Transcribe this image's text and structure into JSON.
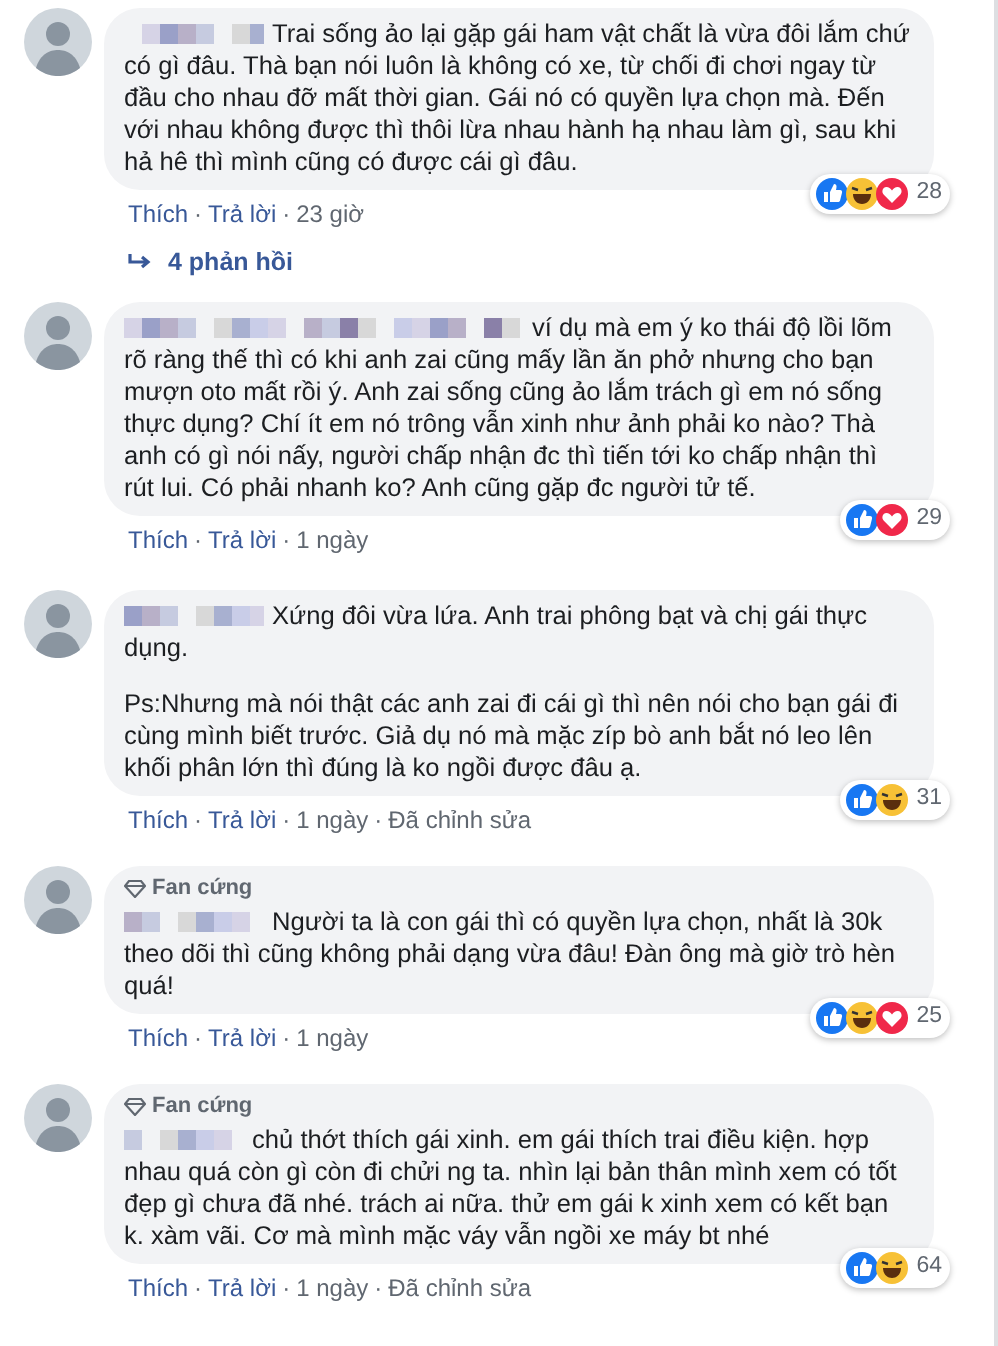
{
  "comments": [
    {
      "paragraphs": [
        "Trai sống ảo lại gặp gái ham vật chất là vừa đôi lắm chứ có gì đâu. Thà bạn nói luôn là không có xe, từ chối đi chơi ngay từ đầu cho nhau đỡ mất thời gian. Gái nó có quyền lựa chọn mà. Đến với nhau không được thì thôi lừa nhau hành hạ nhau làm gì, sau khi hả hê thì mình cũng có được cái gì đâu."
      ],
      "reactions": [
        {
          "kind": "like"
        },
        {
          "kind": "haha"
        },
        {
          "kind": "love"
        }
      ],
      "reaction_count": "28",
      "actions": [
        {
          "kind": "link",
          "text": "Thích"
        },
        {
          "kind": "dot",
          "text": "·"
        },
        {
          "kind": "link",
          "text": "Trả lời"
        },
        {
          "kind": "dot",
          "text": "·"
        },
        {
          "kind": "time",
          "text": "23 giờ"
        }
      ],
      "replies": "4 phản hồi"
    },
    {
      "paragraphs": [
        "ví dụ mà em ý ko thái độ lồi lõm rõ ràng thế thì có khi anh zai cũng mấy lần ăn phở nhưng cho bạn mượn oto mất rồi ý. Anh zai sống cũng ảo lắm trách gì em nó sống thực dụng? Chí ít em nó trông vẫn xinh như ảnh phải ko nào? Thà anh có gì nói nấy, người chấp nhận đc thì tiến tới ko chấp nhận thì rút lui. Có phải nhanh ko? Anh cũng gặp đc người tử tế."
      ],
      "reactions": [
        {
          "kind": "like"
        },
        {
          "kind": "love"
        }
      ],
      "reaction_count": "29",
      "actions": [
        {
          "kind": "link",
          "text": "Thích"
        },
        {
          "kind": "dot",
          "text": "·"
        },
        {
          "kind": "link",
          "text": "Trả lời"
        },
        {
          "kind": "dot",
          "text": "·"
        },
        {
          "kind": "time",
          "text": "1 ngày"
        }
      ]
    },
    {
      "paragraphs": [
        "Xứng đôi vừa lứa. Anh trai phông bạt và chị gái thực dụng.",
        "Ps:Nhưng mà nói thật các anh zai đi cái gì thì nên nói cho bạn gái đi cùng mình biết trước. Giả dụ nó mà mặc zíp bò anh bắt nó leo lên khối phân lớn thì đúng là ko ngồi được đâu ạ."
      ],
      "reactions": [
        {
          "kind": "like"
        },
        {
          "kind": "haha"
        }
      ],
      "reaction_count": "31",
      "actions": [
        {
          "kind": "link",
          "text": "Thích"
        },
        {
          "kind": "dot",
          "text": "·"
        },
        {
          "kind": "link",
          "text": "Trả lời"
        },
        {
          "kind": "dot",
          "text": "·"
        },
        {
          "kind": "time",
          "text": "1 ngày"
        },
        {
          "kind": "dot",
          "text": "·"
        },
        {
          "kind": "time",
          "text": "Đã chỉnh sửa"
        }
      ]
    },
    {
      "badge": "Fan cứng",
      "paragraphs": [
        "Người ta là con gái thì có quyền lựa chọn, nhất là 30k theo dõi thì cũng không phải dạng vừa đâu! Đàn ông mà giờ trò hèn quá!"
      ],
      "reactions": [
        {
          "kind": "like"
        },
        {
          "kind": "haha"
        },
        {
          "kind": "love"
        }
      ],
      "reaction_count": "25",
      "actions": [
        {
          "kind": "link",
          "text": "Thích"
        },
        {
          "kind": "dot",
          "text": "·"
        },
        {
          "kind": "link",
          "text": "Trả lời"
        },
        {
          "kind": "dot",
          "text": "·"
        },
        {
          "kind": "time",
          "text": "1 ngày"
        }
      ]
    },
    {
      "badge": "Fan cứng",
      "paragraphs": [
        "chủ thớt thích gái xinh. em gái thích trai điều kiện. hợp nhau quá còn gì còn đi chửi ng ta. nhìn lại bản thân mình xem có tốt đẹp gì chưa đã nhé. trách ai nữa. thử em gái k xinh xem có kết bạn k. xàm vãi. Cơ mà mình mặc váy vẫn ngồi xe máy bt nhé"
      ],
      "reactions": [
        {
          "kind": "like"
        },
        {
          "kind": "haha"
        }
      ],
      "reaction_count": "64",
      "actions": [
        {
          "kind": "link",
          "text": "Thích"
        },
        {
          "kind": "dot",
          "text": "·"
        },
        {
          "kind": "link",
          "text": "Trả lời"
        },
        {
          "kind": "dot",
          "text": "·"
        },
        {
          "kind": "time",
          "text": "1 ngày"
        },
        {
          "kind": "dot",
          "text": "·"
        },
        {
          "kind": "time",
          "text": "Đã chỉnh sửa"
        }
      ]
    }
  ]
}
